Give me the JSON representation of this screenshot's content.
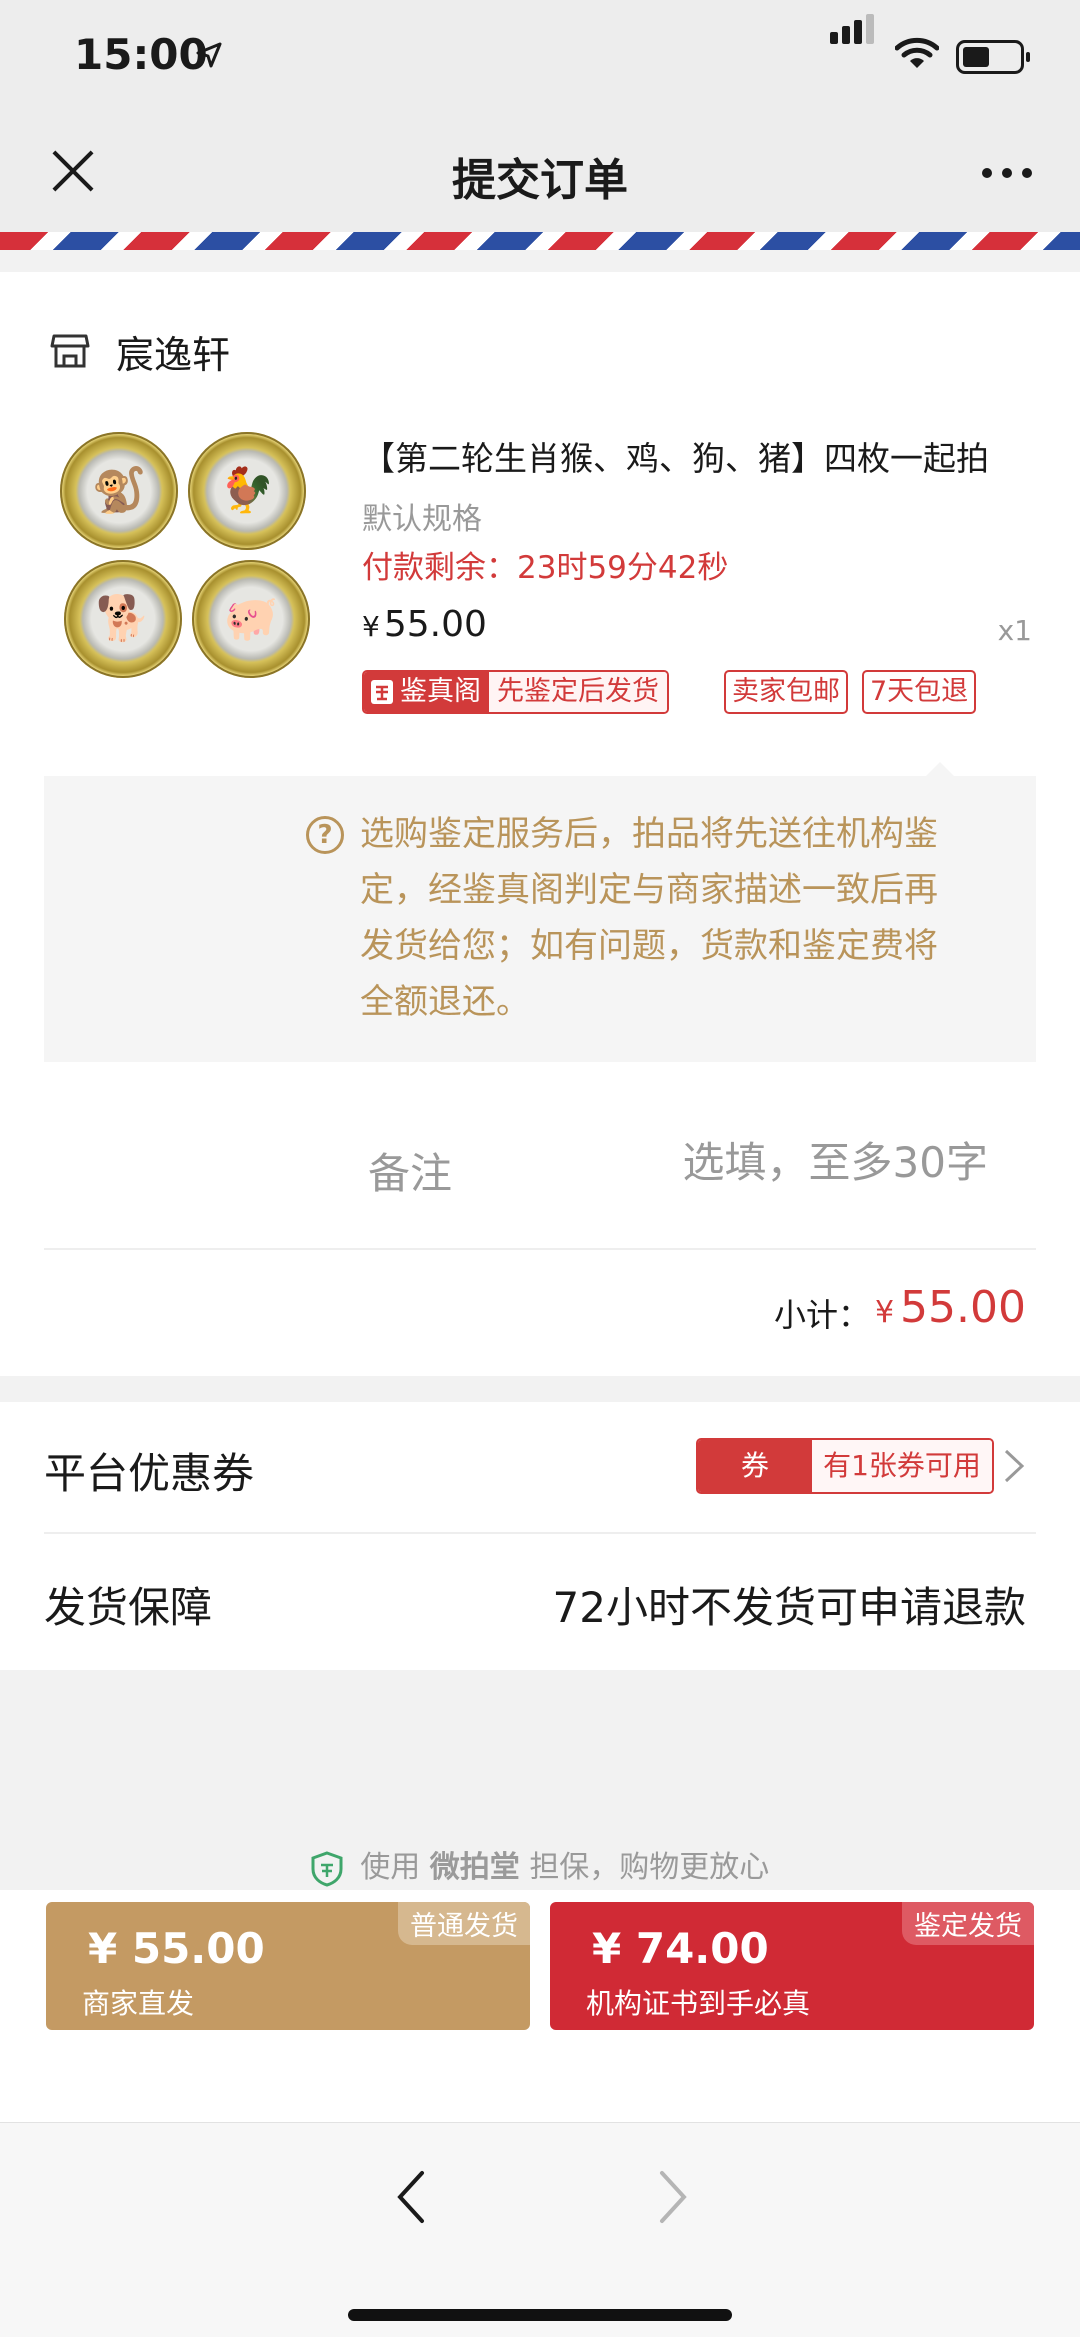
{
  "status_bar": {
    "time": "15:00"
  },
  "nav": {
    "title": "提交订单"
  },
  "shop": {
    "name": "宸逸轩"
  },
  "product": {
    "title": "【第二轮生肖猴、鸡、狗、猪】四枚一起拍",
    "spec": "默认规格",
    "timer": "付款剩余：23时59分42秒",
    "price_symbol": "¥",
    "price": "55.00",
    "quantity": "x1",
    "tags": {
      "authority": "鉴真阁",
      "authority_note": "先鉴定后发货",
      "free_shipping": "卖家包邮",
      "returns": "7天包退"
    }
  },
  "notice": {
    "text": "选购鉴定服务后，拍品将先送往机构鉴定，经鉴真阁判定与商家描述一致后再发货给您；如有问题，货款和鉴定费将全额退还。"
  },
  "remark": {
    "label": "备注",
    "placeholder": "选填，至多30字"
  },
  "subtotal": {
    "label": "小计：",
    "symbol": "¥",
    "value": "55.00"
  },
  "coupon": {
    "label": "平台优惠券",
    "tag": "券",
    "available": "有1张券可用"
  },
  "shipping": {
    "label": "发货保障",
    "value": "72小时不发货可申请退款"
  },
  "guarantee": {
    "prefix": "使用",
    "brand": "微拍堂",
    "suffix": "担保，购物更放心"
  },
  "buttons": {
    "normal": {
      "price": "¥ 55.00",
      "sub": "商家直发",
      "corner": "普通发货"
    },
    "auth": {
      "price": "¥ 74.00",
      "sub": "机构证书到手必真",
      "corner": "鉴定发货"
    }
  },
  "colors": {
    "accent_red": "#d23a3a",
    "gold": "#c49a63",
    "notice_text": "#b9945a"
  }
}
